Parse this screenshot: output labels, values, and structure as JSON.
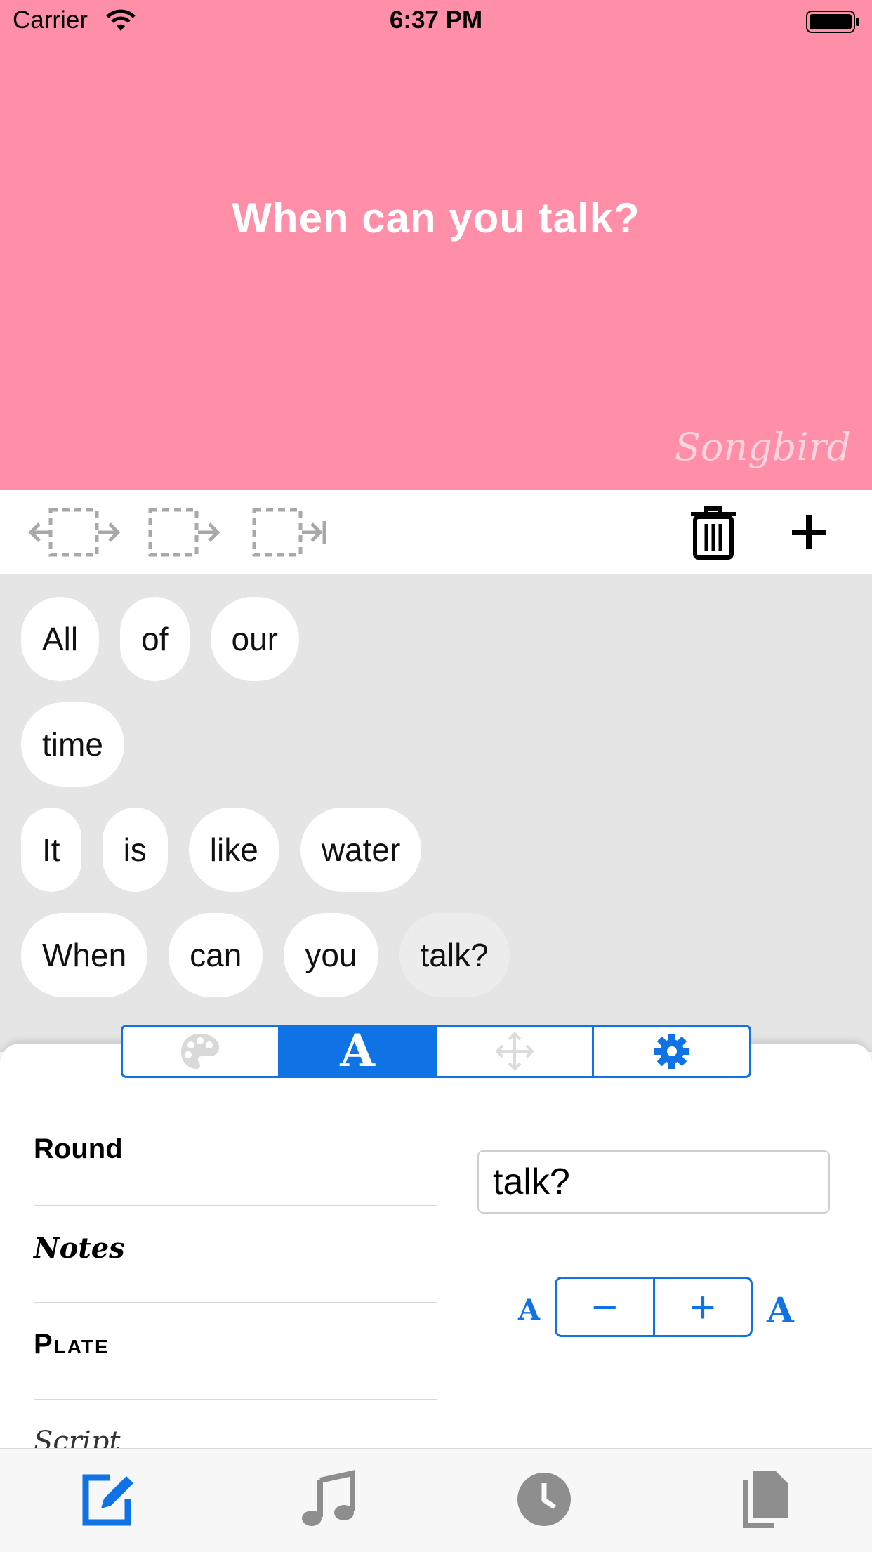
{
  "status_bar": {
    "carrier": "Carrier",
    "time": "6:37 PM"
  },
  "preview": {
    "text": "When can you talk?",
    "background_color": "#ff8ea9",
    "watermark": "Songbird"
  },
  "toolbar": {
    "icons": [
      "insert-before-icon",
      "insert-after-icon",
      "insert-end-icon",
      "trash-icon",
      "plus-icon"
    ]
  },
  "word_rows": [
    [
      "All",
      "of",
      "our"
    ],
    [
      "time"
    ],
    [
      "It",
      "is",
      "like",
      "water"
    ],
    [
      "When",
      "can",
      "you",
      "talk?"
    ]
  ],
  "selected_word": "talk?",
  "segmented_control": {
    "tabs": [
      "palette-icon",
      "font-icon",
      "move-icon",
      "gear-icon"
    ],
    "active_label": "A",
    "accent_color": "#0f72e5"
  },
  "fonts": [
    "Round",
    "Notes",
    "Plate",
    "Script"
  ],
  "text_field": {
    "value": "talk?"
  },
  "size_control": {
    "small_label": "A",
    "large_label": "A",
    "minus": "−",
    "plus": "+"
  },
  "tabbar": {
    "tabs": [
      "edit-icon",
      "music-note-icon",
      "clock-icon",
      "copy-icon"
    ],
    "active_color": "#0f72e5",
    "inactive_color": "#8e8e8e"
  }
}
